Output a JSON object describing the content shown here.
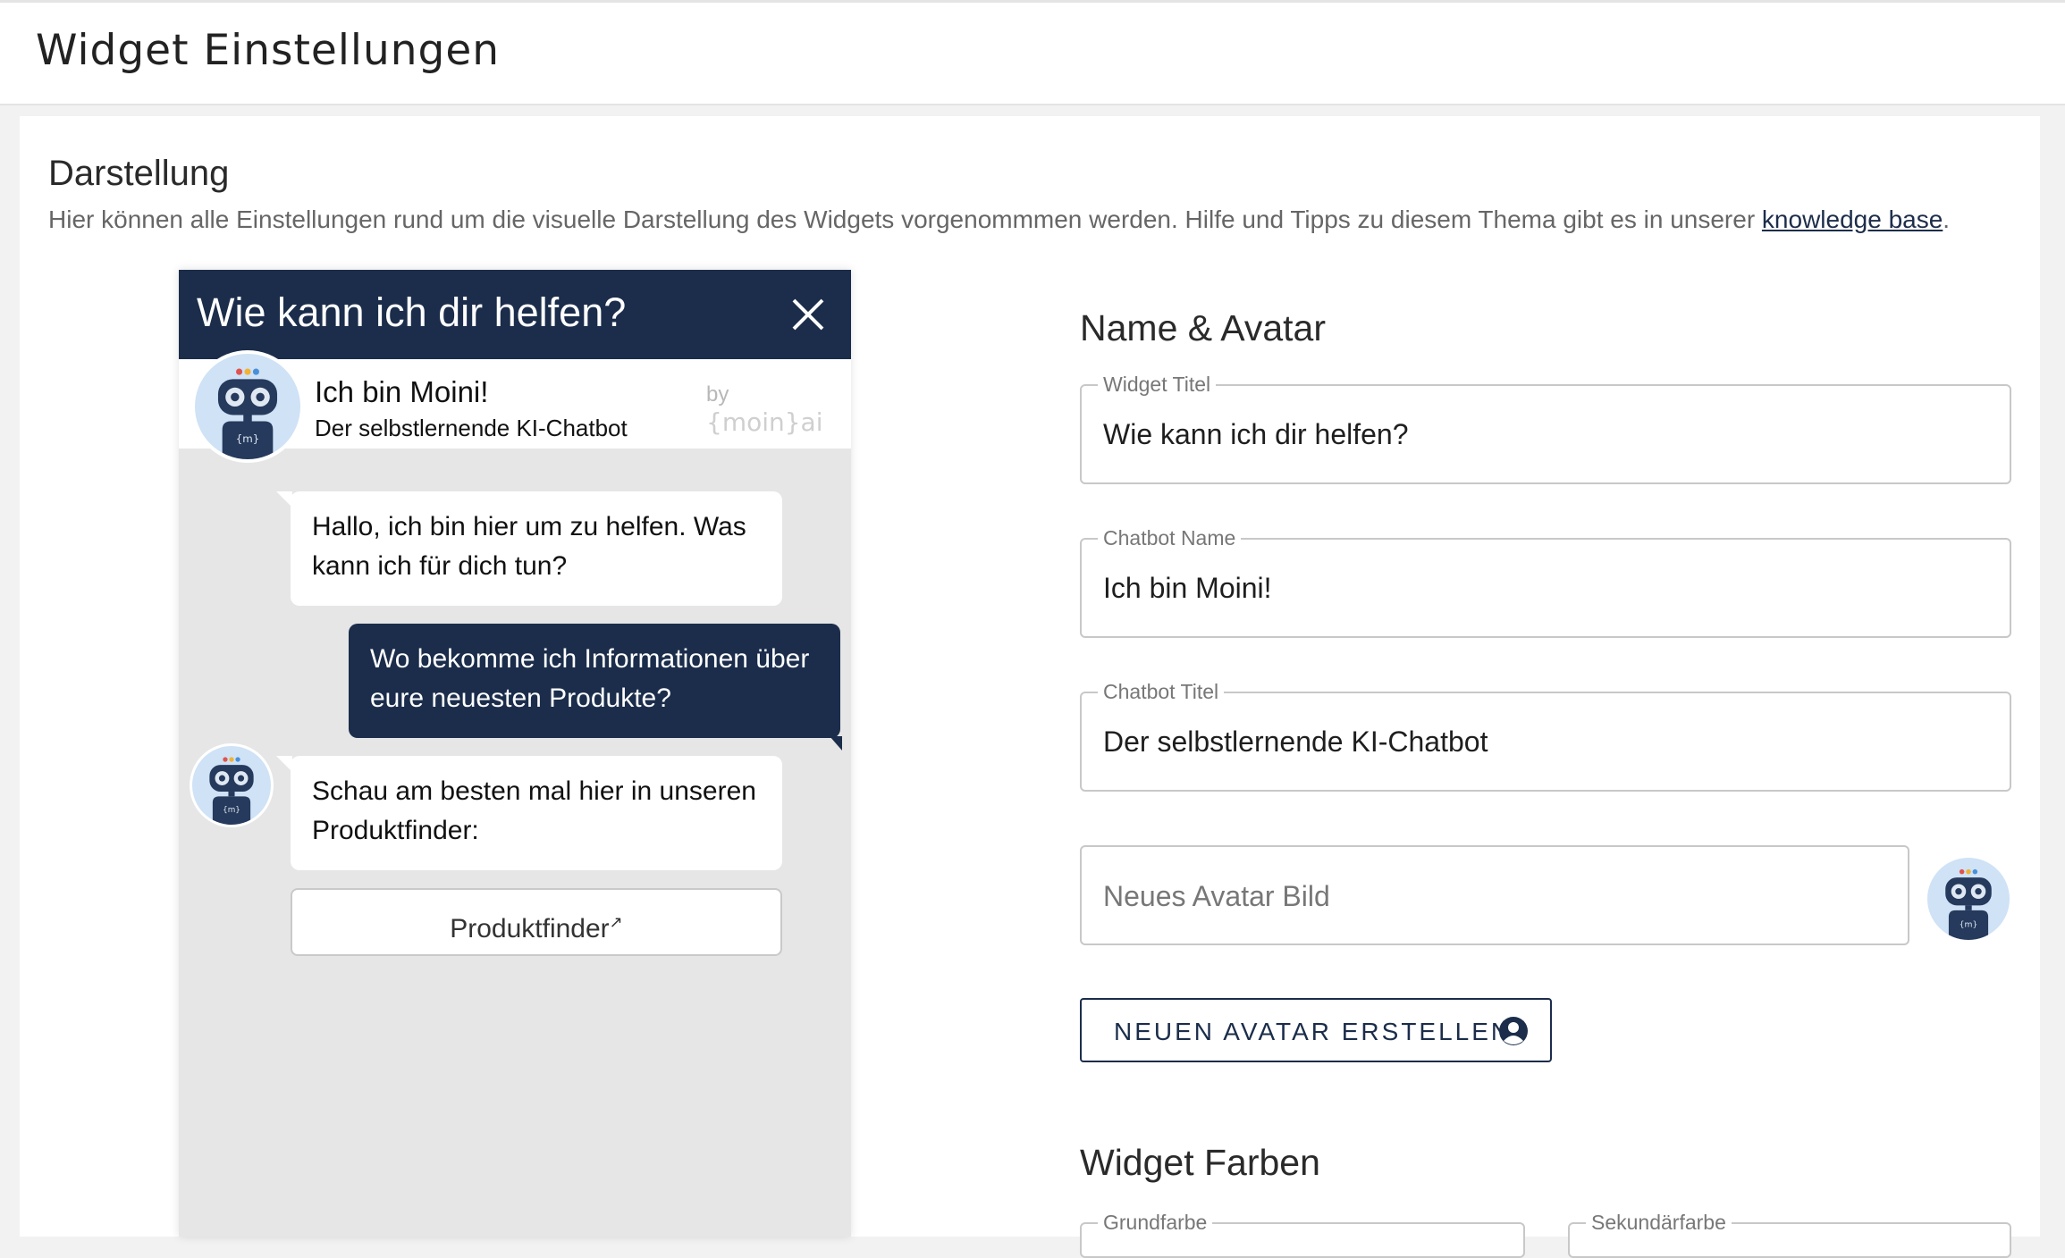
{
  "page": {
    "title": "Widget Einstellungen"
  },
  "section": {
    "title": "Darstellung",
    "description": "Hier können alle Einstellungen rund um die visuelle Darstellung des Widgets vorgenommmen werden. Hilfe und Tipps zu diesem Thema gibt es in unserer ",
    "link_text": "knowledge base",
    "description_end": "."
  },
  "widget_preview": {
    "header_title": "Wie kann ich dir helfen?",
    "bot_name": "Ich bin Moini!",
    "bot_subtitle": "Der selbstlernende KI-Chatbot",
    "brand_prefix": "by",
    "brand_logo": "{moin}ai",
    "messages": [
      {
        "from": "bot",
        "text": "Hallo, ich bin hier um zu helfen. Was kann ich für dich tun?"
      },
      {
        "from": "user",
        "text": "Wo bekomme ich Informationen über eure neuesten Produkte?"
      },
      {
        "from": "bot",
        "text": "Schau am besten mal hier in unseren Produktfinder:"
      }
    ],
    "link_button": "Produktfinder",
    "link_icon": "external-link-icon",
    "close_icon": "close-icon",
    "header_color": "#1b2d4b"
  },
  "name_avatar": {
    "title": "Name & Avatar",
    "widget_title": {
      "label": "Widget Titel",
      "value": "Wie kann ich dir helfen?"
    },
    "chatbot_name": {
      "label": "Chatbot Name",
      "value": "Ich bin Moini!"
    },
    "chatbot_title": {
      "label": "Chatbot Titel",
      "value": "Der selbstlernende KI-Chatbot"
    },
    "avatar_input": {
      "placeholder": "Neues Avatar Bild"
    },
    "create_button": "NEUEN AVATAR ERSTELLEN",
    "create_icon": "user-circle-icon"
  },
  "colors": {
    "title": "Widget Farben",
    "primary_label": "Grundfarbe",
    "secondary_label": "Sekundärfarbe"
  }
}
